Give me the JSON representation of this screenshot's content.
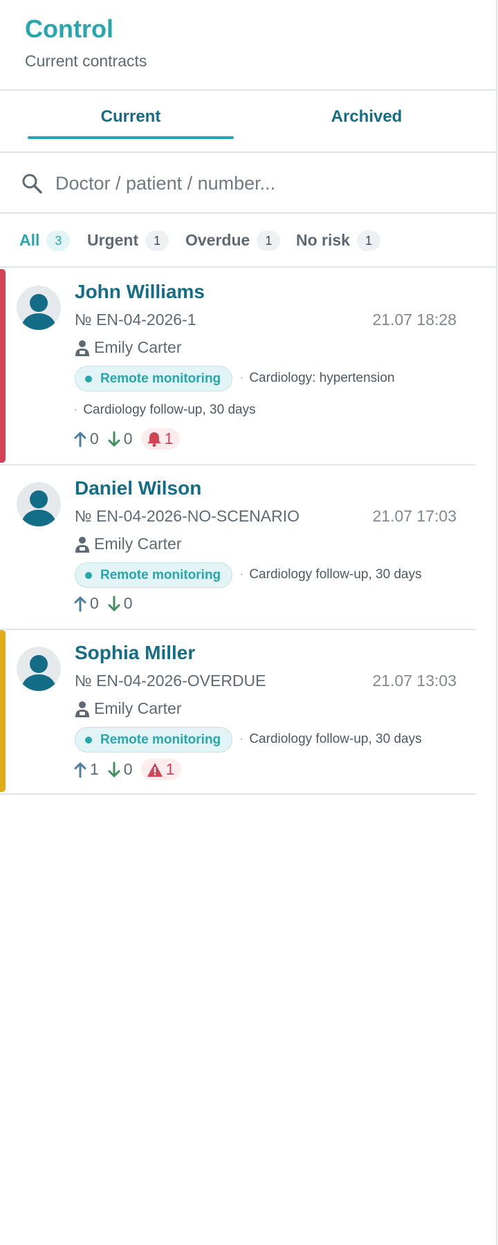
{
  "header": {
    "title": "Control",
    "subtitle": "Current contracts"
  },
  "tabs": [
    {
      "label": "Current",
      "active": true
    },
    {
      "label": "Archived",
      "active": false
    }
  ],
  "search": {
    "placeholder": "Doctor / patient / number...",
    "value": ""
  },
  "filters": [
    {
      "label": "All",
      "count": "3",
      "active": true
    },
    {
      "label": "Urgent",
      "count": "1",
      "active": false
    },
    {
      "label": "Overdue",
      "count": "1",
      "active": false
    },
    {
      "label": "No risk",
      "count": "1",
      "active": false
    }
  ],
  "colors": {
    "accent": "#26a6ad",
    "name": "#146d87",
    "urgent": "#d14455",
    "overdue": "#e0ab1a",
    "up_arrow": "#4a7ea5",
    "down_arrow": "#3f8f5f"
  },
  "contracts": [
    {
      "name": "John Williams",
      "number": "№ EN-04-2026-1",
      "time": "21.07 18:28",
      "doctor": "Emily Carter",
      "program": "Remote monitoring",
      "tags": [
        "Cardiology: hypertension",
        "Cardiology follow-up, 30 days"
      ],
      "up": "0",
      "down": "0",
      "alert_count": "1",
      "alert_icon": "bell-icon",
      "risk": "urgent"
    },
    {
      "name": "Daniel Wilson",
      "number": "№ EN-04-2026-NO-SCENARIO",
      "time": "21.07 17:03",
      "doctor": "Emily Carter",
      "program": "Remote monitoring",
      "tags": [
        "Cardiology follow-up, 30 days"
      ],
      "up": "0",
      "down": "0",
      "risk": "none"
    },
    {
      "name": "Sophia Miller",
      "number": "№ EN-04-2026-OVERDUE",
      "time": "21.07 13:03",
      "doctor": "Emily Carter",
      "program": "Remote monitoring",
      "tags": [
        "Cardiology follow-up, 30 days"
      ],
      "up": "1",
      "down": "0",
      "alert_count": "1",
      "alert_icon": "warning-triangle-icon",
      "risk": "overdue"
    }
  ]
}
